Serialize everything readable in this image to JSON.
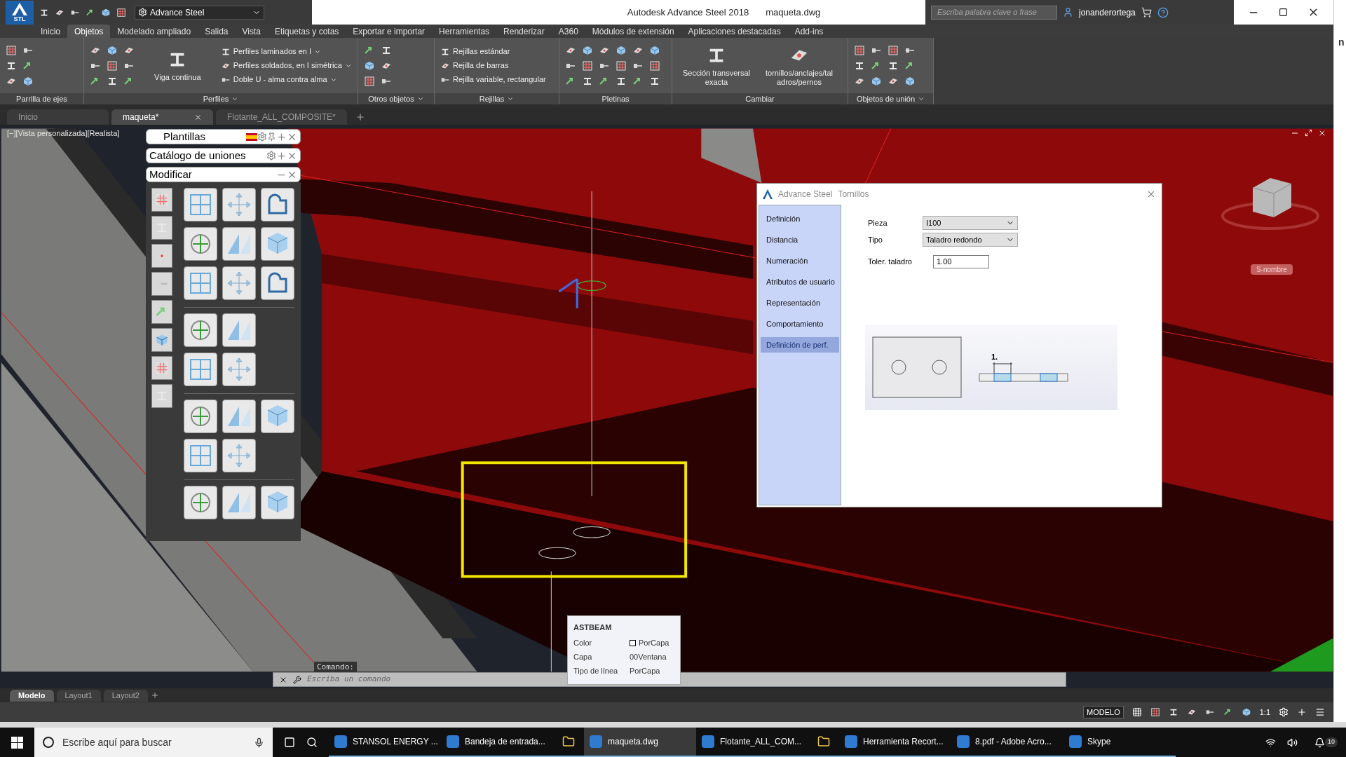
{
  "title_bar": {
    "app_badge": "STL",
    "workspace": "Advance Steel",
    "title": "Autodesk Advance Steel 2018",
    "file": "maqueta.dwg",
    "search_placeholder": "Escriba palabra clave o frase",
    "user": "jonanderortega"
  },
  "ribbon_tabs": [
    {
      "label": "Inicio",
      "selected": false
    },
    {
      "label": "Objetos",
      "selected": true
    },
    {
      "label": "Modelado ampliado",
      "selected": false
    },
    {
      "label": "Salida",
      "selected": false
    },
    {
      "label": "Vista",
      "selected": false
    },
    {
      "label": "Etiquetas y cotas",
      "selected": false
    },
    {
      "label": "Exportar e importar",
      "selected": false
    },
    {
      "label": "Herramientas",
      "selected": false
    },
    {
      "label": "Renderizar",
      "selected": false
    },
    {
      "label": "A360",
      "selected": false
    },
    {
      "label": "Módulos de extensión",
      "selected": false
    },
    {
      "label": "Aplicaciones destacadas",
      "selected": false
    },
    {
      "label": "Add-ins",
      "selected": false
    }
  ],
  "ribbon_panels": [
    {
      "title": "Parrilla de ejes",
      "menu": false
    },
    {
      "title": "Perfiles",
      "menu": true,
      "big_buttons": [
        "Viga continua"
      ],
      "list_items": [
        {
          "label": "Perfiles laminados en I",
          "dropdown": true
        },
        {
          "label": "Perfiles soldados, en I simétrica",
          "dropdown": true
        },
        {
          "label": "Doble U - alma contra alma",
          "dropdown": true
        }
      ]
    },
    {
      "title": "Otros objetos",
      "menu": true
    },
    {
      "title": "Rejillas",
      "menu": true,
      "list_items": [
        {
          "label": "Rejillas estándar",
          "dropdown": false
        },
        {
          "label": "Rejilla de barras",
          "dropdown": false
        },
        {
          "label": "Rejilla variable, rectangular",
          "dropdown": false
        }
      ]
    },
    {
      "title": "Pletinas",
      "menu": false
    },
    {
      "title": "Cambiar",
      "menu": false,
      "big_buttons": [
        "Sección transversal exacta",
        "tornillos/anclajes/taladros/pernos"
      ]
    },
    {
      "title": "Objetos de unión",
      "menu": true
    }
  ],
  "document_tabs": [
    {
      "label": "Inicio",
      "selected": false
    },
    {
      "label": "maqueta*",
      "selected": true
    },
    {
      "label": "Flotante_ALL_COMPOSITE*",
      "selected": false
    }
  ],
  "viewport": {
    "label": "[−][Vista personalizada][Realista]",
    "viewcube_badge": "S-nombre"
  },
  "palettes": [
    {
      "title": "Plantillas",
      "kind": "full"
    },
    {
      "title": "Catálogo de uniones",
      "kind": "settings"
    },
    {
      "title": "Modificar",
      "kind": "minimal"
    }
  ],
  "dialog": {
    "app": "Advance Steel",
    "title": "Tornillos",
    "sections": [
      {
        "label": "Definición",
        "selected": false
      },
      {
        "label": "Distancia",
        "selected": false
      },
      {
        "label": "Numeración",
        "selected": false
      },
      {
        "label": "Atributos de usuario",
        "selected": false
      },
      {
        "label": "Representación",
        "selected": false
      },
      {
        "label": "Comportamiento",
        "selected": false
      },
      {
        "label": "Definición de perf.",
        "selected": true
      }
    ],
    "fields": [
      {
        "label": "Pieza",
        "kind": "select",
        "value": "I100"
      },
      {
        "label": "Tipo",
        "kind": "select",
        "value": "Taladro redondo"
      },
      {
        "label": "Toler. taladro",
        "kind": "input",
        "value": "1.00"
      }
    ],
    "dimension_label": "1."
  },
  "tooltip": {
    "title": "ASTBEAM",
    "rows": [
      {
        "label": "Color",
        "value": "PorCapa",
        "kind": "swatch"
      },
      {
        "label": "Capa",
        "value": "00Ventana",
        "kind": "text"
      },
      {
        "label": "Tipo de línea",
        "value": "PorCapa",
        "kind": "text"
      }
    ]
  },
  "command": {
    "prompt_label": "Comando:",
    "placeholder": "Escriba un comando"
  },
  "layout_tabs": [
    {
      "label": "Modelo",
      "selected": true
    },
    {
      "label": "Layout1",
      "selected": false
    },
    {
      "label": "Layout2",
      "selected": false
    }
  ],
  "status_bar": {
    "mode": "MODELO",
    "scale": "1:1"
  },
  "taskbar": {
    "search_placeholder": "Escribe aquí para buscar",
    "apps": [
      {
        "kind": "labeled",
        "label": "STANSOL ENERGY ...",
        "active": false
      },
      {
        "kind": "labeled",
        "label": "Bandeja de entrada...",
        "active": false
      },
      {
        "kind": "icon_only",
        "active": false
      },
      {
        "kind": "labeled",
        "label": "maqueta.dwg",
        "active": true
      },
      {
        "kind": "labeled",
        "label": "Flotante_ALL_COM...",
        "active": false
      },
      {
        "kind": "icon_only",
        "active": false
      },
      {
        "kind": "labeled",
        "label": "Herramienta Recort...",
        "active": false
      },
      {
        "kind": "labeled",
        "label": "8.pdf - Adobe Acro...",
        "active": false
      },
      {
        "kind": "labeled",
        "label": "Skype",
        "active": false
      }
    ],
    "notification_count": "10"
  },
  "background_window_fragment": "n"
}
